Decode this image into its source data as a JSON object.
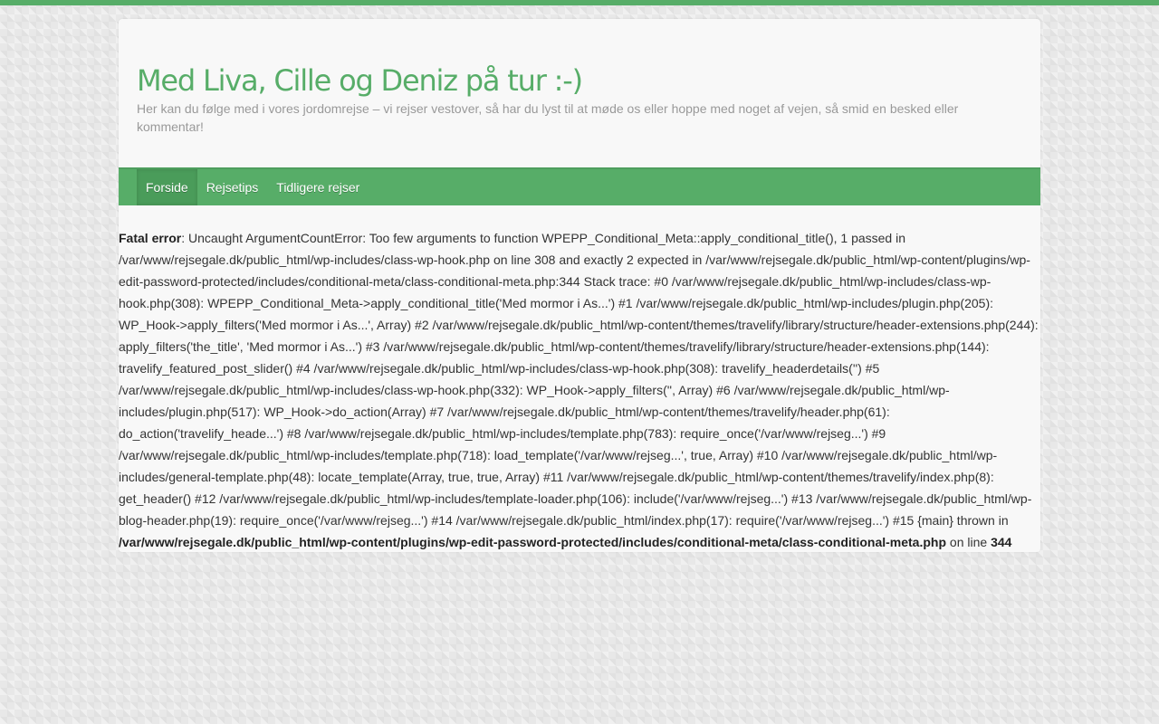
{
  "colors": {
    "accent": "#57ad68",
    "accent_dark": "#4a9c5a",
    "page_background": "#e8e8e8",
    "content_background": "#f8f8f8",
    "description_text": "#999999"
  },
  "header": {
    "site_title": "Med Liva, Cille og Deniz på tur :-)",
    "site_description": "Her kan du følge med i vores jordomrejse – vi rejser vestover, så har du lyst til at møde os eller hoppe med noget af vejen, så smid en besked eller kommentar!"
  },
  "nav": {
    "items": [
      {
        "label": "Forside",
        "active": true
      },
      {
        "label": "Rejsetips",
        "active": false
      },
      {
        "label": "Tidligere rejser",
        "active": false
      }
    ]
  },
  "error": {
    "label": "Fatal error",
    "message": ": Uncaught ArgumentCountError: Too few arguments to function WPEPP_Conditional_Meta::apply_conditional_title(), 1 passed in /var/www/rejsegale.dk/public_html/wp-includes/class-wp-hook.php on line 308 and exactly 2 expected in /var/www/rejsegale.dk/public_html/wp-content/plugins/wp-edit-password-protected/includes/conditional-meta/class-conditional-meta.php:344 Stack trace: #0 /var/www/rejsegale.dk/public_html/wp-includes/class-wp-hook.php(308): WPEPP_Conditional_Meta->apply_conditional_title('Med mormor i As...') #1 /var/www/rejsegale.dk/public_html/wp-includes/plugin.php(205): WP_Hook->apply_filters('Med mormor i As...', Array) #2 /var/www/rejsegale.dk/public_html/wp-content/themes/travelify/library/structure/header-extensions.php(244): apply_filters('the_title', 'Med mormor i As...') #3 /var/www/rejsegale.dk/public_html/wp-content/themes/travelify/library/structure/header-extensions.php(144): travelify_featured_post_slider() #4 /var/www/rejsegale.dk/public_html/wp-includes/class-wp-hook.php(308): travelify_headerdetails('') #5 /var/www/rejsegale.dk/public_html/wp-includes/class-wp-hook.php(332): WP_Hook->apply_filters('', Array) #6 /var/www/rejsegale.dk/public_html/wp-includes/plugin.php(517): WP_Hook->do_action(Array) #7 /var/www/rejsegale.dk/public_html/wp-content/themes/travelify/header.php(61): do_action('travelify_heade...') #8 /var/www/rejsegale.dk/public_html/wp-includes/template.php(783): require_once('/var/www/rejseg...') #9 /var/www/rejsegale.dk/public_html/wp-includes/template.php(718): load_template('/var/www/rejseg...', true, Array) #10 /var/www/rejsegale.dk/public_html/wp-includes/general-template.php(48): locate_template(Array, true, true, Array) #11 /var/www/rejsegale.dk/public_html/wp-content/themes/travelify/index.php(8): get_header() #12 /var/www/rejsegale.dk/public_html/wp-includes/template-loader.php(106): include('/var/www/rejseg...') #13 /var/www/rejsegale.dk/public_html/wp-blog-header.php(19): require_once('/var/www/rejseg...') #14 /var/www/rejsegale.dk/public_html/index.php(17): require('/var/www/rejseg...') #15 {main} thrown in ",
    "file": "/var/www/rejsegale.dk/public_html/wp-content/plugins/wp-edit-password-protected/includes/conditional-meta/class-conditional-meta.php",
    "on_line_text": " on line ",
    "line": "344"
  }
}
